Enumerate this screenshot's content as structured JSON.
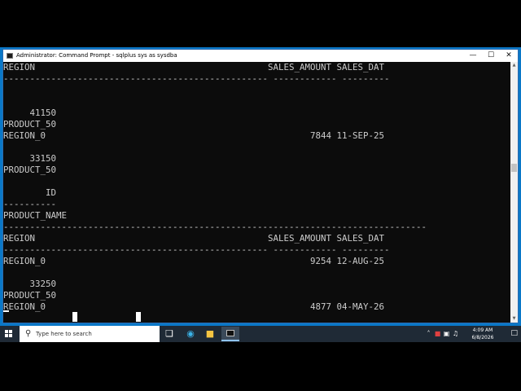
{
  "window": {
    "title": "Administrator: Command Prompt - sqlplus  sys as sysdba",
    "minimize_icon": "minimize-icon",
    "maximize_icon": "maximize-icon",
    "close_icon": "close-icon"
  },
  "console": {
    "lines": [
      "REGION                                            SALES_AMOUNT SALES_DAT",
      "-------------------------------------------------- ------------ ---------",
      "",
      "",
      "     41150",
      "PRODUCT_50",
      "REGION_0                                                  7844 11-SEP-25",
      "",
      "     33150",
      "PRODUCT_50",
      "",
      "        ID",
      "----------",
      "PRODUCT_NAME",
      "--------------------------------------------------------------------------------",
      "REGION                                            SALES_AMOUNT SALES_DAT",
      "-------------------------------------------------- ------------ ---------",
      "REGION_0                                                  9254 12-AUG-25",
      "",
      "     33250",
      "PRODUCT_50",
      "REGION_0                                                  4877 04-MAY-26"
    ]
  },
  "taskbar": {
    "search_placeholder": "Type here to search",
    "time": "4:09 AM",
    "date": "6/8/2026"
  },
  "colors": {
    "console_bg": "#0c0c0c",
    "console_text": "#cccccc",
    "desktop": "#0a78c8",
    "taskbar": "#1f2a36"
  }
}
